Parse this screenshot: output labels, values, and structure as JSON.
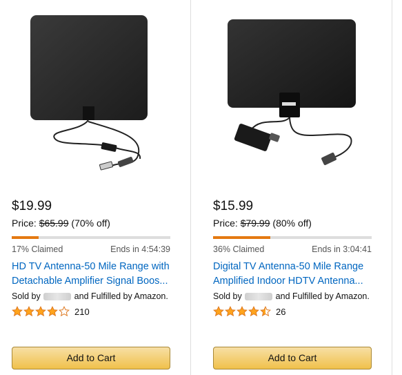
{
  "products": [
    {
      "price": "$19.99",
      "price_label": "Price:",
      "list_price": "$65.99",
      "discount": "(70% off)",
      "claimed_percent": 17,
      "claimed_text": "17% Claimed",
      "ends_text": "Ends in 4:54:39",
      "title_line1": "HD TV Antenna-50 Mile Range with",
      "title_line2": "Detachable Amplifier Signal Boos...",
      "seller_prefix": "Sold by",
      "seller_suffix": "and Fulfilled by Amazon.",
      "rating": 4,
      "review_count": "210",
      "cart_label": "Add to Cart"
    },
    {
      "price": "$15.99",
      "price_label": "Price:",
      "list_price": "$79.99",
      "discount": "(80% off)",
      "claimed_percent": 36,
      "claimed_text": "36% Claimed",
      "ends_text": "Ends in 3:04:41",
      "title_line1": "Digital TV Antenna-50 Mile Range",
      "title_line2": "Amplified Indoor HDTV Antenna...",
      "seller_prefix": "Sold by",
      "seller_suffix": "and Fulfilled by Amazon.",
      "rating": 4.5,
      "review_count": "26",
      "cart_label": "Add to Cart"
    }
  ],
  "product_images": [
    "tv-antenna-image",
    "tv-antenna-amplifier-image"
  ],
  "colors": {
    "link": "#0066c0",
    "claim_bar": "#e47911",
    "star": "#ffa41c",
    "button": "#f0c14b"
  }
}
